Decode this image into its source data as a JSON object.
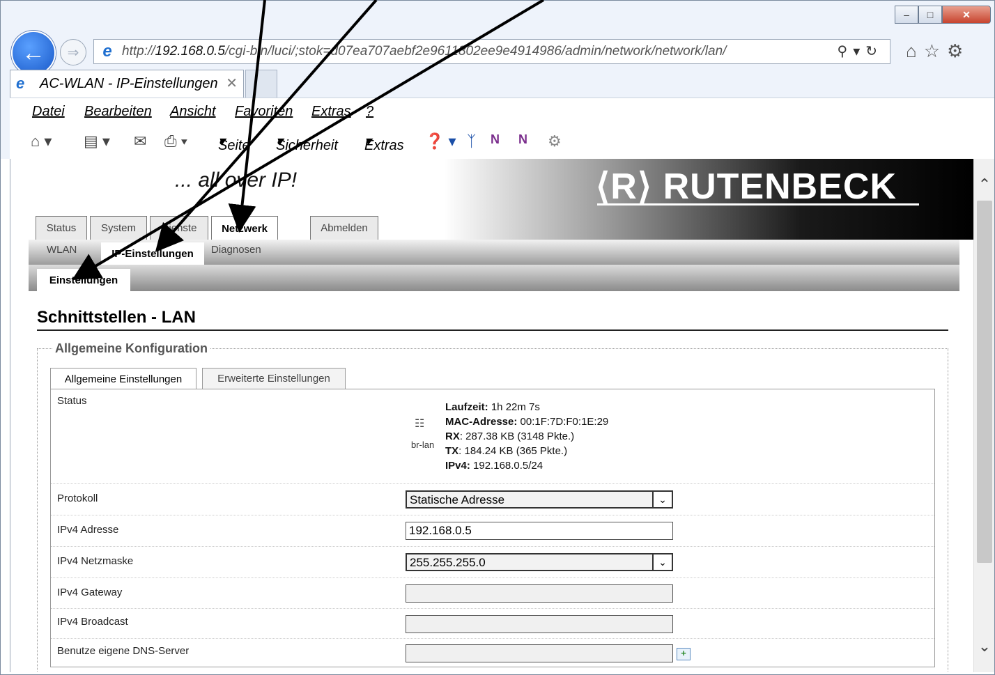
{
  "browser": {
    "url_prefix": "http://",
    "url_host": "192.168.0.5",
    "url_rest": "/cgi-bin/luci/;stok=d07ea707aebf2e9611802ee9e4914986/admin/network/network/lan/",
    "tab_title": "AC-WLAN - IP-Einstellungen",
    "menu": [
      "Datei",
      "Bearbeiten",
      "Ansicht",
      "Favoriten",
      "Extras",
      "?"
    ],
    "command_bar": {
      "seite": "Seite",
      "sicherheit": "Sicherheit",
      "extras": "Extras"
    },
    "window_buttons": {
      "minimize": "–",
      "maximize": "□",
      "close": "✕"
    }
  },
  "header": {
    "slogan": "... all over IP!",
    "logo": "⟨R⟩ RUTENBECK"
  },
  "main_tabs": [
    "Status",
    "System",
    "Dienste",
    "Netzwerk",
    "Abmelden"
  ],
  "sub_tabs": [
    "WLAN",
    "IP-Einstellungen",
    "Diagnosen"
  ],
  "sub_tabs2": [
    "Einstellungen"
  ],
  "page": {
    "title": "Schnittstellen - LAN",
    "legend": "Allgemeine Konfiguration",
    "config_tabs": [
      "Allgemeine Einstellungen",
      "Erweiterte Einstellungen"
    ]
  },
  "status": {
    "label": "Status",
    "iface": "br-lan",
    "lines": [
      {
        "key": "Laufzeit:",
        "value": " 1h 22m 7s"
      },
      {
        "key": "MAC-Adresse:",
        "value": " 00:1F:7D:F0:1E:29"
      },
      {
        "key": "RX",
        "value": ": 287.38 KB (3148 Pkte.)"
      },
      {
        "key": "TX",
        "value": ": 184.24 KB (365 Pkte.)"
      },
      {
        "key": "IPv4:",
        "value": " 192.168.0.5/24"
      }
    ]
  },
  "form": {
    "protokoll": {
      "label": "Protokoll",
      "value": "Statische Adresse"
    },
    "ipv4_adresse": {
      "label": "IPv4 Adresse",
      "value": "192.168.0.5"
    },
    "ipv4_netzmaske": {
      "label": "IPv4 Netzmaske",
      "value": "255.255.255.0"
    },
    "ipv4_gateway": {
      "label": "IPv4 Gateway",
      "value": ""
    },
    "ipv4_broadcast": {
      "label": "IPv4 Broadcast",
      "value": ""
    },
    "dns": {
      "label": "Benutze eigene DNS-Server",
      "value": ""
    }
  }
}
